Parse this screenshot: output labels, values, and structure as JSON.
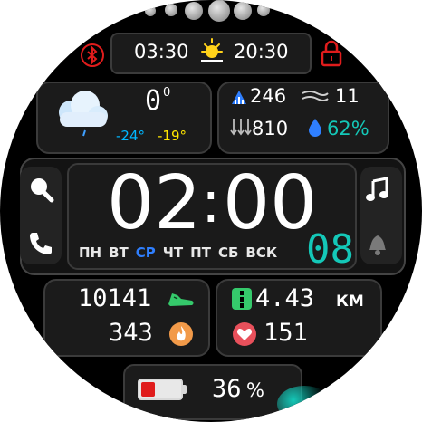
{
  "top": {
    "sunrise": "03:30",
    "sunset": "20:30",
    "bluetooth_icon": "bluetooth-icon",
    "lock_icon": "lock-icon",
    "sun_icon": "sun-icon"
  },
  "weather": {
    "temp": "0",
    "temp_unit": "0",
    "low": "-24°",
    "high": "-19°",
    "icon": "cloud-rain-icon"
  },
  "env": {
    "uv_value": "246",
    "wind_value": "11",
    "pressure_value": "810",
    "humidity_value": "62%"
  },
  "time": {
    "hours": "02",
    "colon": ":",
    "minutes": "00",
    "date": "08"
  },
  "days": [
    "ПН",
    "ВТ",
    "СР",
    "ЧТ",
    "ПТ",
    "СБ",
    "ВСК"
  ],
  "active_day_index": 2,
  "activity": {
    "steps": "10141",
    "calories": "343",
    "distance": "4.43",
    "distance_unit": "КМ",
    "heart_rate": "151"
  },
  "battery": {
    "percent_text": "36",
    "percent_sign": "%",
    "level": 0.36
  },
  "colors": {
    "accent_teal": "#14c8b8",
    "accent_blue": "#2f7fff",
    "cold_blue": "#00b7ff",
    "warm_yellow": "#ffe600",
    "warning_red": "#e01c1c",
    "step_green": "#35c96b"
  }
}
